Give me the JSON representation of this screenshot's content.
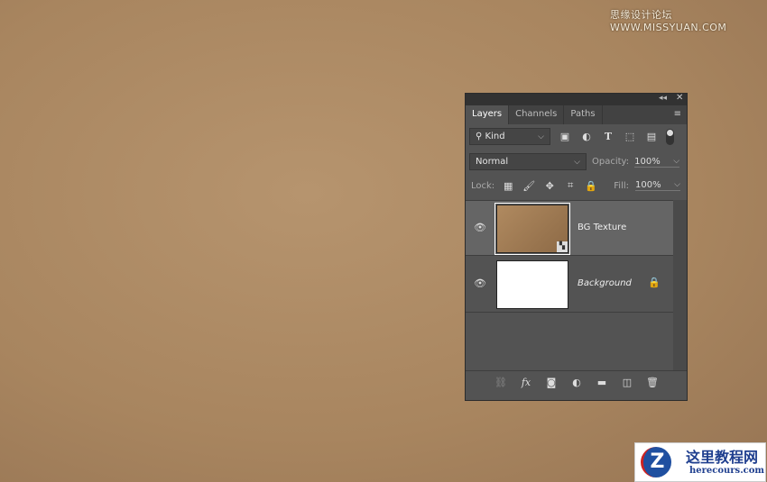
{
  "watermark": {
    "text": "思缘设计论坛 WWW.MISSYUAN.COM"
  },
  "panel": {
    "header_icons": [
      "collapse-icon",
      "close-icon"
    ],
    "tabs": [
      {
        "label": "Layers",
        "active": true
      },
      {
        "label": "Channels"
      },
      {
        "label": "Paths"
      }
    ],
    "filter": {
      "label": "Kind"
    },
    "blend_mode": "Normal",
    "opacity_label": "Opacity:",
    "opacity_value": "100%",
    "lock_label": "Lock:",
    "fill_label": "Fill:",
    "fill_value": "100%",
    "layers": [
      {
        "name": "BG Texture",
        "selected": true,
        "visible": true
      },
      {
        "name": "Background",
        "locked": true,
        "visible": true
      }
    ]
  },
  "logo": {
    "name": "这里教程网",
    "url": "herecours.com"
  }
}
